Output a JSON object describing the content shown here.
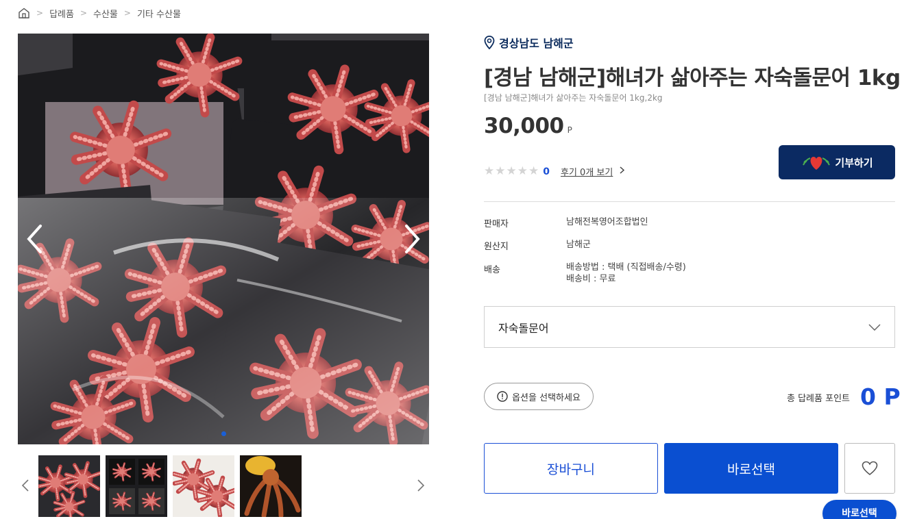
{
  "breadcrumb": {
    "home_icon": "home-icon",
    "items": [
      "답례품",
      "수산물",
      "기타 수산물"
    ],
    "separator": ">"
  },
  "gallery": {
    "main_image_alt": "octopus-in-trays-photo",
    "prev_icon": "chevron-left-icon",
    "next_icon": "chevron-right-icon",
    "dot_count": 1,
    "thumbnails": [
      "octopus-single-photo",
      "octopus-trays-photo",
      "octopus-orange-photo",
      "octopus-held-photo"
    ]
  },
  "product": {
    "region": "경상남도 남해군",
    "title": "[경남 남해군]해녀가 삶아주는 자숙돌문어 1kg",
    "subtitle": "[경남 남해군]해녀가 삶아주는 자숙돌문어 1kg,2kg",
    "price": "30,000",
    "price_unit": "P",
    "rating_value": 0,
    "rating_count": "0",
    "review_link": "후기 0개 보기",
    "donate_label": "기부하기"
  },
  "info": {
    "seller_label": "판매자",
    "seller_value": "남해전복영어조합법인",
    "origin_label": "원산지",
    "origin_value": "남해군",
    "shipping_label": "배송",
    "shipping_method": "배송방법 : 택배 (직접배송/수령)",
    "shipping_fee": "배송비 : 무료"
  },
  "option": {
    "selected": "자숙돌문어",
    "hint": "옵션을 선택하세요"
  },
  "points": {
    "label": "총 답례품 포인트",
    "value": "0 P"
  },
  "actions": {
    "cart": "장바구니",
    "buy": "바로선택",
    "floating_buy": "바로선택",
    "wishlist_icon": "heart-icon"
  },
  "colors": {
    "brand_navy": "#0b2a62",
    "brand_blue": "#0a4fd1",
    "accent_blue": "#1a4fd6"
  }
}
